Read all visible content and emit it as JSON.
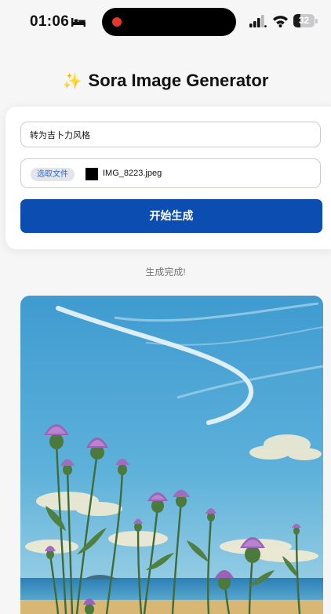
{
  "status_bar": {
    "time": "01:06",
    "battery_level": "32",
    "battery_fraction": 0.32,
    "icons": [
      "bed-icon",
      "signal-icon",
      "wifi-icon",
      "battery-icon"
    ]
  },
  "header": {
    "icon": "sparkle-icon",
    "title": "Sora Image Generator"
  },
  "form": {
    "prompt_value": "转为吉卜力风格",
    "file_button_label": "选取文件",
    "file_name": "IMG_8223.jpeg",
    "submit_label": "开始生成"
  },
  "status": {
    "message": "生成完成!"
  },
  "result": {
    "description": "generated-image"
  },
  "colors": {
    "accent": "#0b4db0",
    "recording_dot": "#e5372b"
  }
}
